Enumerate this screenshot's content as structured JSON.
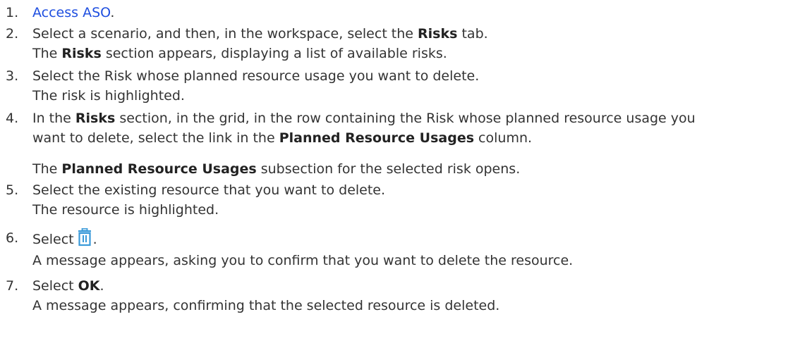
{
  "steps": [
    {
      "num": "1.",
      "link": "Access ASO",
      "link_after": "."
    },
    {
      "num": "2.",
      "l1_a": "Select a scenario, and then, in the workspace, select the ",
      "l1_b": "Risks",
      "l1_c": " tab.",
      "l2_a": "The ",
      "l2_b": "Risks",
      "l2_c": " section appears, displaying a list of available risks."
    },
    {
      "num": "3.",
      "l1": "Select the Risk whose planned resource usage you want to delete.",
      "l2": "The risk is highlighted."
    },
    {
      "num": "4.",
      "l1_a": "In the ",
      "l1_b": "Risks",
      "l1_c": " section, in the grid, in the row containing the Risk whose planned resource usage you",
      "l2_a": "want to delete, select the link in the ",
      "l2_b": "Planned Resource Usages",
      "l2_c": " column.",
      "l3_a": "The ",
      "l3_b": "Planned Resource Usages",
      "l3_c": " subsection for the selected risk opens."
    },
    {
      "num": "5.",
      "l1": "Select the existing resource that you want to delete.",
      "l2": "The resource is highlighted."
    },
    {
      "num": "6.",
      "l1_a": "Select",
      "icon": "trash-icon",
      "l1_c": ".",
      "l2": "A message appears, asking you to confirm that you want to delete the resource."
    },
    {
      "num": "7.",
      "l1_a": "Select ",
      "l1_b": "OK",
      "l1_c": ".",
      "l2": "A message appears, confirming that the selected resource is deleted."
    }
  ],
  "colors": {
    "text": "#333333",
    "link": "#1f4fe0",
    "icon": "#3a9ad9"
  }
}
